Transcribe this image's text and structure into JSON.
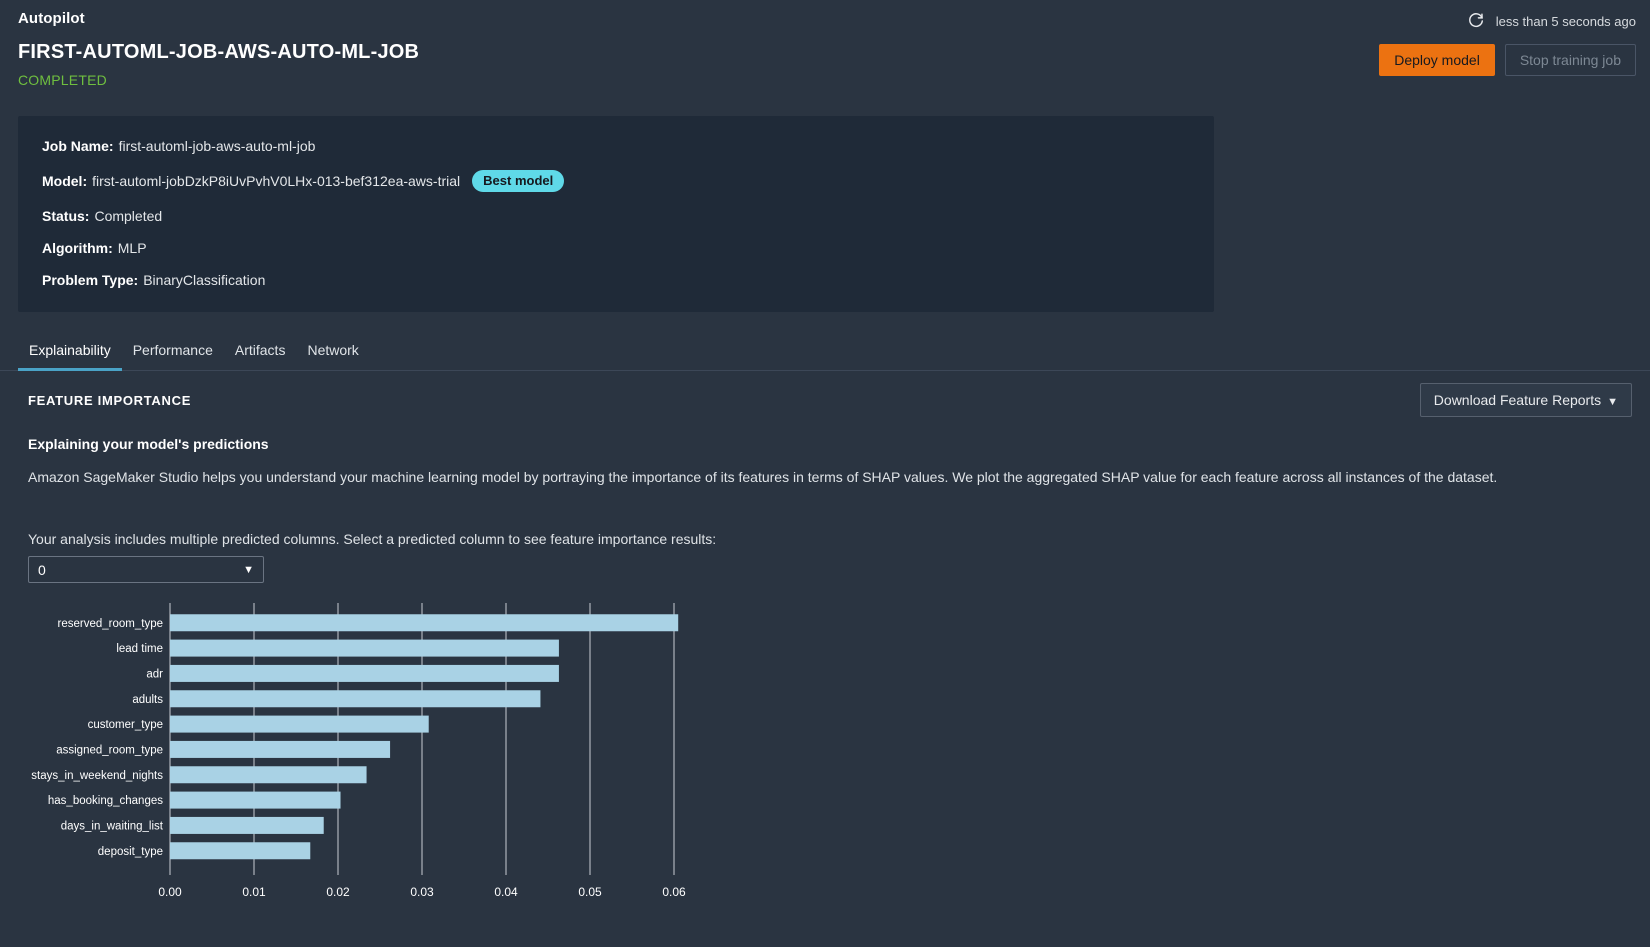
{
  "header": {
    "app_title": "Autopilot",
    "job_title": "FIRST-AUTOML-JOB-AWS-AUTO-ML-JOB",
    "job_status": "COMPLETED",
    "refresh_icon": "refresh-icon",
    "refresh_time": "less than 5 seconds ago",
    "deploy_button": "Deploy model",
    "stop_button": "Stop training job"
  },
  "info_card": {
    "rows": [
      {
        "label": "Job Name:",
        "value": "first-automl-job-aws-auto-ml-job"
      },
      {
        "label": "Model:",
        "value": "first-automl-jobDzkP8iUvPvhV0LHx-013-bef312ea-aws-trial",
        "badge": "Best model"
      },
      {
        "label": "Status:",
        "value": "Completed"
      },
      {
        "label": "Algorithm:",
        "value": "MLP"
      },
      {
        "label": "Problem Type:",
        "value": "BinaryClassification"
      }
    ]
  },
  "tabs": [
    {
      "label": "Explainability",
      "active": true
    },
    {
      "label": "Performance",
      "active": false
    },
    {
      "label": "Artifacts",
      "active": false
    },
    {
      "label": "Network",
      "active": false
    }
  ],
  "main": {
    "section_title": "FEATURE IMPORTANCE",
    "download_button": "Download Feature Reports",
    "download_caret": "▼",
    "sub_head": "Explaining your model's predictions",
    "body_text": "Amazon SageMaker Studio helps you understand your machine learning model by portraying the importance of its features in terms of SHAP values. We plot the aggregated SHAP value for each feature across all instances of the dataset.",
    "select_label": "Your analysis includes multiple predicted columns. Select a predicted column to see feature importance results:",
    "select_value": "0",
    "select_caret": "▼"
  },
  "colors": {
    "page_bg": "#2a3441",
    "card_bg": "#1f2a38",
    "accent_orange": "#ec7211",
    "badge_cyan": "#5fd9e8",
    "status_green": "#6fbf3f",
    "tab_active": "#4aa3c7",
    "bar_fill": "#a9d2e5",
    "gridline": "#c8cdd3"
  },
  "chart_data": {
    "type": "bar",
    "orientation": "horizontal",
    "title": "",
    "xlabel": "",
    "ylabel": "",
    "xlim": [
      0,
      0.06
    ],
    "xticks": [
      "0.00",
      "0.01",
      "0.02",
      "0.03",
      "0.04",
      "0.05",
      "0.06"
    ],
    "xtick_values": [
      0.0,
      0.01,
      0.02,
      0.03,
      0.04,
      0.05,
      0.06
    ],
    "grid": true,
    "legend": false,
    "categories": [
      "reserved_room_type",
      "lead  time",
      "adr",
      "adults",
      "customer_type",
      "assigned_room_type",
      "stays_in_weekend_nights",
      "has_booking_changes",
      "days_in_waiting_list",
      "deposit_type"
    ],
    "values": [
      0.0605,
      0.0463,
      0.0463,
      0.0441,
      0.0308,
      0.0262,
      0.0234,
      0.0203,
      0.0183,
      0.0167
    ]
  }
}
